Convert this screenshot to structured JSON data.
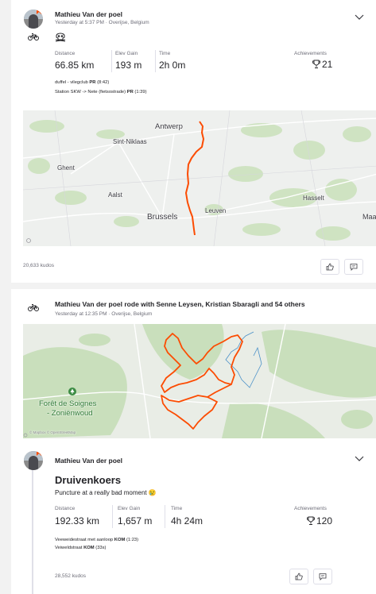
{
  "activity1": {
    "athlete": "Mathieu Van der poel",
    "meta": "Yesterday at 5:37 PM · Overijse, Belgium",
    "stats": [
      {
        "label": "Distance",
        "value": "66.85 km"
      },
      {
        "label": "Elev Gain",
        "value": "193 m"
      },
      {
        "label": "Time",
        "value": "2h 0m"
      }
    ],
    "achievements_label": "Achievements",
    "achievements_count": "21",
    "segments": [
      {
        "name": "duffel - vilegclub",
        "badge": "PR",
        "time": "(8:42)"
      },
      {
        "name": "Station SKW -> Nete (fietsostrade)",
        "badge": "PR",
        "time": "(1:39)"
      }
    ],
    "map_labels": [
      "Antwerp",
      "Sint-Niklaas",
      "Ghent",
      "Aalst",
      "Brussels",
      "Leuven",
      "Hasselt",
      "Maa"
    ],
    "kudos": "20,633 kudos"
  },
  "group": {
    "header": "Mathieu Van der poel rode with Senne Leysen, Kristian Sbaragli and 54 others",
    "meta": "Yesterday at 12:35 PM · Overijse, Belgium",
    "map_labels": [
      "Forêt de Soignes",
      "- Zoniënwoud"
    ],
    "attribution": "© Mapbox © OpenStreetMap"
  },
  "activity2": {
    "athlete": "Mathieu Van der poel",
    "title": "Druivenkoers",
    "description": "Puncture at a really bad moment 😢",
    "stats": [
      {
        "label": "Distance",
        "value": "192.33 km"
      },
      {
        "label": "Elev Gain",
        "value": "1,657 m"
      },
      {
        "label": "Time",
        "value": "4h 24m"
      }
    ],
    "achievements_label": "Achievements",
    "achievements_count": "120",
    "segments": [
      {
        "name": "Veeweidestraat met aanloop",
        "badge": "KOM",
        "time": "(1:23)"
      },
      {
        "name": "Veiweldstraat",
        "badge": "KOM",
        "time": "(33s)"
      }
    ],
    "kudos": "28,552 kudos"
  },
  "colors": {
    "route": "#fc4c02",
    "brand": "#fc4c02",
    "text": "#242428",
    "muted": "#6d6d78",
    "map_green": "#cfe3c2"
  }
}
